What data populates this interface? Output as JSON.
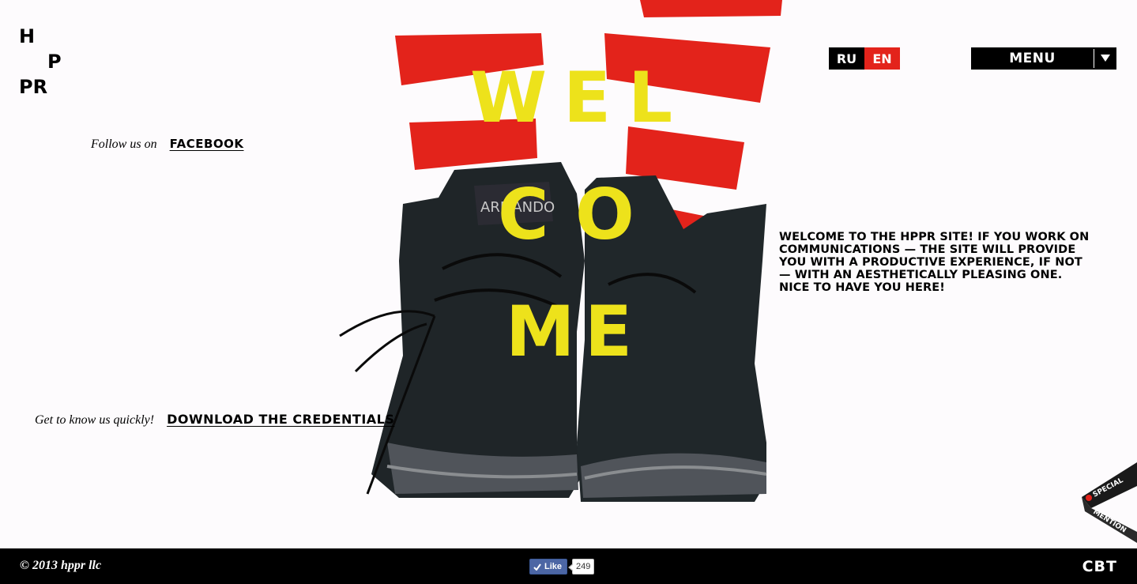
{
  "logo": {
    "line1": "H",
    "line2": "P",
    "line3": "PR"
  },
  "follow": {
    "text": "Follow us on",
    "link": "FACEBOOK"
  },
  "credentials": {
    "text": "Get to know us quickly!",
    "link": "DOWNLOAD THE CREDENTIALS"
  },
  "hero": {
    "letters": [
      "W",
      "E",
      "L",
      "C",
      "O",
      "M",
      "E"
    ],
    "boot_label": "ARMANDO",
    "colors": {
      "headline": "#ede21b",
      "stripe": "#e3231b",
      "boot": "#1f2528"
    }
  },
  "language": {
    "ru": "RU",
    "en": "EN",
    "active": "EN"
  },
  "menu": {
    "label": "MENU"
  },
  "intro": "Welcome to the HPPR site! If you work on communications — the site will provide you with a productive experience, if not — with an aesthetically pleasing one. Nice to have you here!",
  "badge": {
    "line1": "SPECIAL",
    "line2": "MENTION"
  },
  "footer": {
    "copyright": "© 2013 hppr llc",
    "like_label": "Like",
    "like_count": "249",
    "brand": "CBT"
  }
}
